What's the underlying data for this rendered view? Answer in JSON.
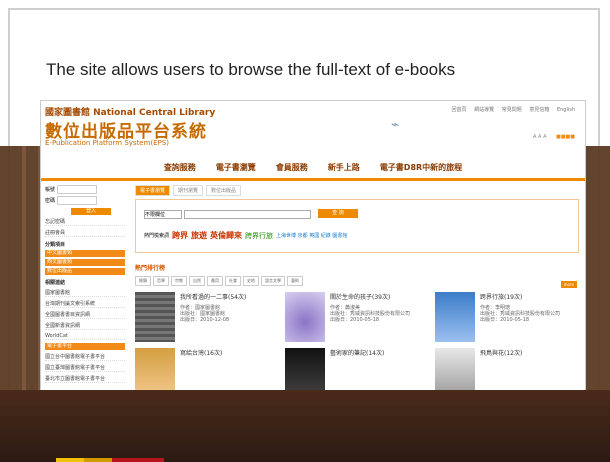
{
  "slide_caption": "The site allows users to browse the full-text of e-books",
  "site": {
    "logo_line1": "國家圖書館 National Central Library",
    "logo_line2": "數位出版品平台系統",
    "logo_line3": "E-Publication Platform System(EPS)",
    "top_links": [
      "回首頁",
      "網站導覽",
      "常見問題",
      "意見信箱",
      "English"
    ],
    "font_controls": "A A A",
    "color_controls": "■■■■"
  },
  "nav": {
    "items": [
      "查詢服務",
      "電子書瀏覽",
      "會員服務",
      "新手上路",
      "電子書D8R中新的旅程"
    ]
  },
  "sidebar": {
    "account_label": "帳號",
    "password_label": "密碼",
    "login_button": "登入",
    "links_top": [
      "忘記密碼",
      "註冊會員"
    ],
    "category_title": "分類項目",
    "category_items": [
      "中文圖書類",
      "西文圖書類",
      "數位出版品"
    ],
    "related_title": "相關連結",
    "related_items": [
      "國家圖書館",
      "台灣期刊論文索引系統",
      "全國圖書書目資訊網",
      "全國新書資訊網",
      "WorldCat"
    ],
    "platform_title": "電子書平台",
    "platform_items": [
      "國立台中圖書館電子書平台",
      "國立臺灣圖書館電子書平台",
      "臺北市立圖書館電子書平台"
    ]
  },
  "main": {
    "tabs": [
      "電子書瀏覽",
      "期刊瀏覽",
      "數位出版品"
    ],
    "search_select": "不限欄位",
    "search_button": "查 詢",
    "hot_label": "熱門檢索詞",
    "hot_words": [
      "跨界",
      "旅遊",
      "英倫歸來",
      "跨界行旅"
    ],
    "hot_small": "上海世博 京都 英國 紀錄 圖書館",
    "section_title": "熱門排行榜",
    "more_button": "more",
    "subtabs": [
      "總類",
      "哲學",
      "宗教",
      "自然",
      "應用",
      "社會",
      "史地",
      "語言文學",
      "藝術"
    ],
    "books": [
      {
        "title": "我所看過的一二事(54次)",
        "author": "作者：國家圖書館",
        "publisher": "出版社：國家圖書館",
        "date": "出版日：2010-12-08"
      },
      {
        "title": "關於生命的孩子(39次)",
        "author": "作者：蕭淑美",
        "publisher": "出版社：秀威資訊科技股份有限公司",
        "date": "出版日：2010-05-18"
      },
      {
        "title": "跨界行旅(19次)",
        "author": "作者：李明璁",
        "publisher": "出版社：秀威資訊科技股份有限公司",
        "date": "出版日：2010-05-18"
      },
      {
        "title": "寫給台灣(16次)",
        "author": "",
        "publisher": "",
        "date": ""
      },
      {
        "title": "藝術家的筆記(14次)",
        "author": "",
        "publisher": "",
        "date": ""
      },
      {
        "title": "飛鳥與花(12次)",
        "author": "",
        "publisher": "",
        "date": ""
      }
    ]
  }
}
